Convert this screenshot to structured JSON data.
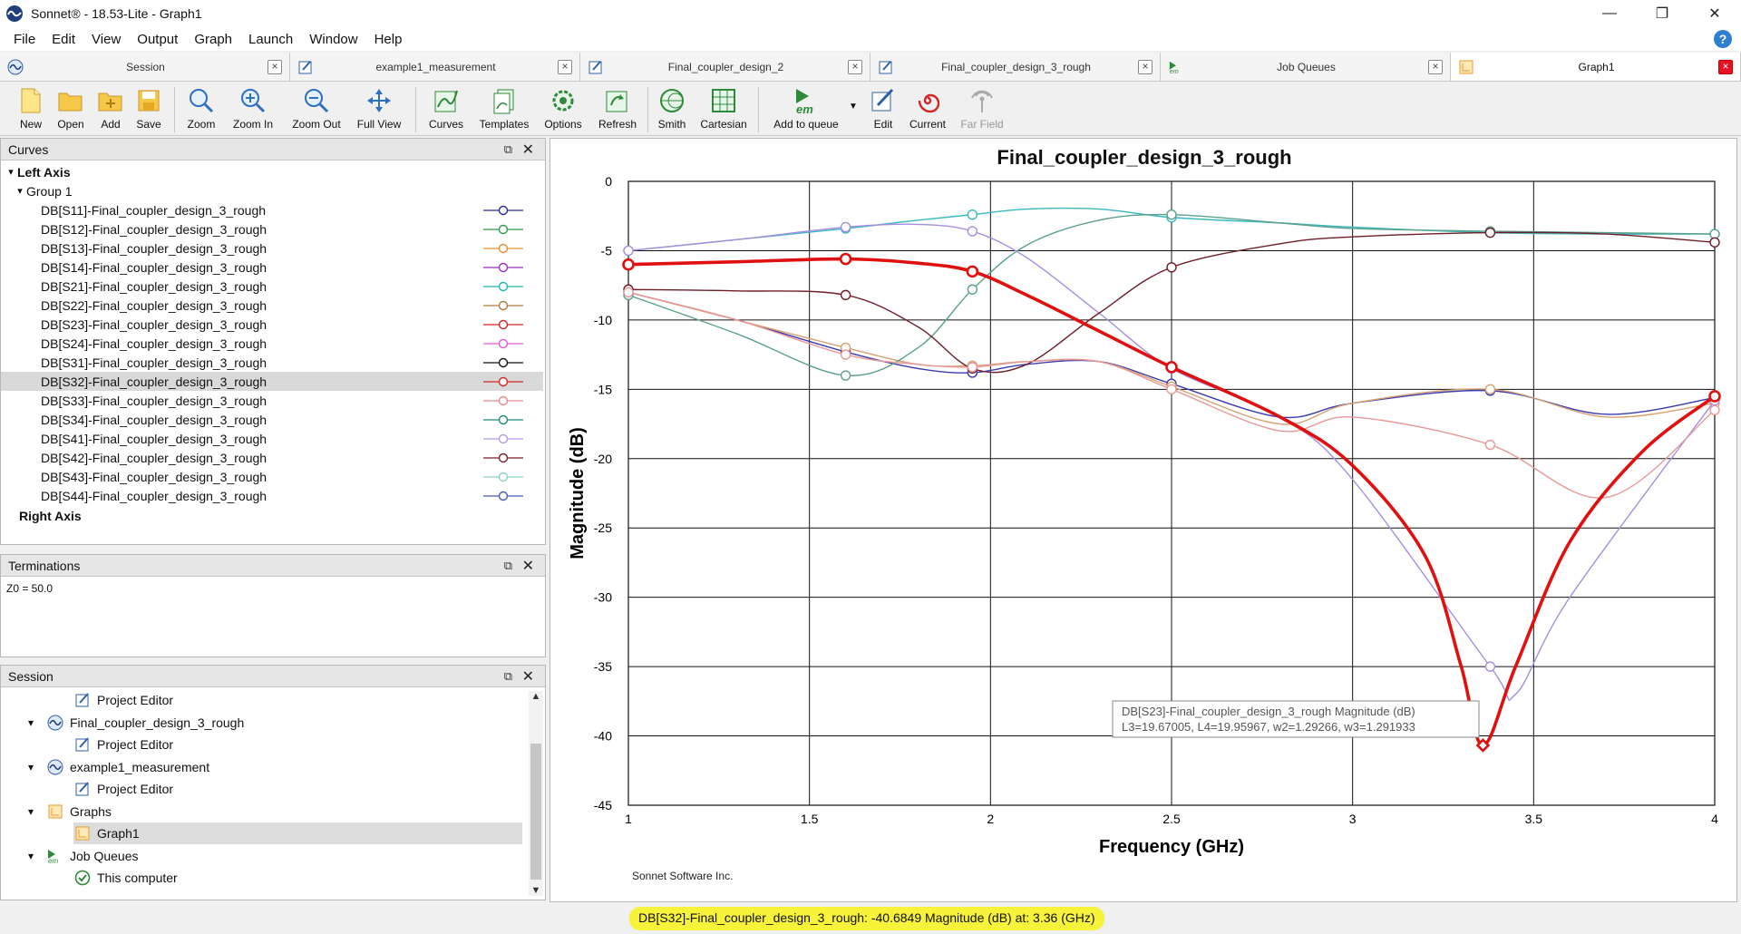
{
  "window": {
    "title": "Sonnet® - 18.53-Lite - Graph1",
    "minimize": "—",
    "restore": "❐",
    "close": "✕"
  },
  "menu": [
    "File",
    "Edit",
    "View",
    "Output",
    "Graph",
    "Launch",
    "Window",
    "Help"
  ],
  "help_glyph": "?",
  "tabs": [
    {
      "label": "Session",
      "icon": "session-icon",
      "active": false
    },
    {
      "label": "example1_measurement",
      "icon": "project-editor-icon",
      "active": false
    },
    {
      "label": "Final_coupler_design_2",
      "icon": "project-editor-icon",
      "active": false
    },
    {
      "label": "Final_coupler_design_3_rough",
      "icon": "project-editor-icon",
      "active": false
    },
    {
      "label": "Job Queues",
      "icon": "em-icon",
      "active": false
    },
    {
      "label": "Graph1",
      "icon": "graph-icon",
      "active": true
    }
  ],
  "tab_close": "×",
  "toolbar": {
    "new": "New",
    "open": "Open",
    "add": "Add",
    "save": "Save",
    "zoom": "Zoom",
    "zoom_in": "Zoom In",
    "zoom_out": "Zoom Out",
    "full_view": "Full View",
    "curves": "Curves",
    "templates": "Templates",
    "options": "Options",
    "refresh": "Refresh",
    "smith": "Smith",
    "cartesian": "Cartesian",
    "add_to_queue": "Add to queue",
    "edit": "Edit",
    "current": "Current",
    "far_field": "Far Field"
  },
  "curves_panel": {
    "title": "Curves",
    "left_axis": "Left Axis",
    "group": "Group 1",
    "right_axis": "Right Axis",
    "items": [
      {
        "label": "DB[S11]-Final_coupler_design_3_rough",
        "color": "#2b2b9e"
      },
      {
        "label": "DB[S12]-Final_coupler_design_3_rough",
        "color": "#2e9a4a"
      },
      {
        "label": "DB[S13]-Final_coupler_design_3_rough",
        "color": "#e8902c"
      },
      {
        "label": "DB[S14]-Final_coupler_design_3_rough",
        "color": "#9a2fc4"
      },
      {
        "label": "DB[S21]-Final_coupler_design_3_rough",
        "color": "#1fb8b8"
      },
      {
        "label": "DB[S22]-Final_coupler_design_3_rough",
        "color": "#b07a3a"
      },
      {
        "label": "DB[S23]-Final_coupler_design_3_rough",
        "color": "#d42424"
      },
      {
        "label": "DB[S24]-Final_coupler_design_3_rough",
        "color": "#e05ad8"
      },
      {
        "label": "DB[S31]-Final_coupler_design_3_rough",
        "color": "#111111"
      },
      {
        "label": "DB[S32]-Final_coupler_design_3_rough",
        "color": "#d42424"
      },
      {
        "label": "DB[S33]-Final_coupler_design_3_rough",
        "color": "#e88a8a"
      },
      {
        "label": "DB[S34]-Final_coupler_design_3_rough",
        "color": "#1d8a7a"
      },
      {
        "label": "DB[S41]-Final_coupler_design_3_rough",
        "color": "#b59ae8"
      },
      {
        "label": "DB[S42]-Final_coupler_design_3_rough",
        "color": "#7a1f2a"
      },
      {
        "label": "DB[S43]-Final_coupler_design_3_rough",
        "color": "#8ad6b8"
      },
      {
        "label": "DB[S44]-Final_coupler_design_3_rough",
        "color": "#4a5ab0"
      }
    ],
    "selected_index": 9
  },
  "terminations": {
    "title": "Terminations",
    "text": "Z0 = 50.0"
  },
  "session": {
    "title": "Session",
    "rows": [
      {
        "label": "Project Editor",
        "icon": "project-editor-icon",
        "indent": 2,
        "chevron": ""
      },
      {
        "label": "Final_coupler_design_3_rough",
        "icon": "session-icon",
        "indent": 1,
        "chevron": "▾"
      },
      {
        "label": "Project Editor",
        "icon": "project-editor-icon",
        "indent": 2,
        "chevron": ""
      },
      {
        "label": "example1_measurement",
        "icon": "session-icon",
        "indent": 1,
        "chevron": "▾"
      },
      {
        "label": "Project Editor",
        "icon": "project-editor-icon",
        "indent": 2,
        "chevron": ""
      },
      {
        "label": "Graphs",
        "icon": "graph-icon",
        "indent": 1,
        "chevron": "▾"
      },
      {
        "label": "Graph1",
        "icon": "graph-icon",
        "indent": 2,
        "chevron": ""
      },
      {
        "label": "Job Queues",
        "icon": "em-icon",
        "indent": 1,
        "chevron": "▾"
      },
      {
        "label": "This computer",
        "icon": "check-icon",
        "indent": 2,
        "chevron": ""
      }
    ],
    "selected_index": 6
  },
  "panel_float": "⧉",
  "panel_close": "✕",
  "graph": {
    "title": "Final_coupler_design_3_rough",
    "xlabel": "Frequency (GHz)",
    "ylabel": "Magnitude (dB)",
    "footer": "Sonnet Software Inc.",
    "tooltip_line1": "DB[S23]-Final_coupler_design_3_rough Magnitude (dB)",
    "tooltip_line2": "L3=19.67005, L4=19.95967, w2=1.29266, w3=1.291933"
  },
  "status_text": "DB[S32]-Final_coupler_design_3_rough: -40.6849 Magnitude (dB) at: 3.36 (GHz)",
  "chart_data": {
    "type": "line",
    "title": "Final_coupler_design_3_rough",
    "xlabel": "Frequency (GHz)",
    "ylabel": "Magnitude (dB)",
    "xlim": [
      1,
      4
    ],
    "ylim": [
      -45,
      0
    ],
    "xticks": [
      "1",
      "1.5",
      "2",
      "2.5",
      "3",
      "3.5",
      "4"
    ],
    "yticks": [
      "0",
      "-5",
      "-10",
      "-15",
      "-20",
      "-25",
      "-30",
      "-35",
      "-40",
      "-45"
    ],
    "grid": true,
    "highlight_series": "DB[S32]-Final_coupler_design_3_rough",
    "marker_x": [
      1,
      1.6,
      1.95,
      2.5,
      3.38,
      4
    ],
    "series": [
      {
        "name": "DB[S11]-Final_coupler_design_3_rough",
        "color": "#3a3ab0",
        "x": [
          1,
          1.3,
          1.6,
          1.8,
          1.95,
          2.1,
          2.3,
          2.5,
          2.8,
          3.0,
          3.38,
          3.7,
          4
        ],
        "y": [
          -8,
          -10,
          -12.3,
          -13.5,
          -13.8,
          -13.2,
          -13.0,
          -14.6,
          -17.0,
          -16.0,
          -15.1,
          -16.8,
          -15.6
        ]
      },
      {
        "name": "DB[S13]-Final_coupler_design_3_rough",
        "color": "#d8a070",
        "x": [
          1,
          1.3,
          1.6,
          1.8,
          1.95,
          2.1,
          2.3,
          2.5,
          2.8,
          3.0,
          3.38,
          3.7,
          4
        ],
        "y": [
          -8,
          -10,
          -12,
          -13.2,
          -13.3,
          -13.0,
          -13.0,
          -14.8,
          -17.5,
          -16.0,
          -15.0,
          -17.0,
          -16.0
        ]
      },
      {
        "name": "DB[S21]-Final_coupler_design_3_rough",
        "color": "#3ab8c0",
        "x": [
          1,
          1.3,
          1.6,
          1.8,
          1.95,
          2.1,
          2.3,
          2.5,
          2.8,
          3.0,
          3.38,
          3.7,
          4
        ],
        "y": [
          -5,
          -4.2,
          -3.4,
          -2.8,
          -2.4,
          -2.0,
          -2.0,
          -2.6,
          -3.0,
          -3.3,
          -3.7,
          -3.8,
          -3.8
        ]
      },
      {
        "name": "DB[S34]-Final_coupler_design_3_rough",
        "color": "#5aa08a",
        "x": [
          1,
          1.3,
          1.6,
          1.8,
          1.95,
          2.1,
          2.3,
          2.5,
          2.8,
          3.0,
          3.38,
          3.7,
          4
        ],
        "y": [
          -8.2,
          -11,
          -14,
          -12,
          -7.8,
          -4.6,
          -2.8,
          -2.4,
          -3.0,
          -3.4,
          -3.6,
          -3.7,
          -3.8
        ]
      },
      {
        "name": "DB[S41]-Final_coupler_design_3_rough",
        "color": "#a78ee0",
        "x": [
          1,
          1.3,
          1.6,
          1.8,
          1.95,
          2.1,
          2.3,
          2.5,
          2.8,
          3.0,
          3.38,
          3.45,
          3.6,
          4
        ],
        "y": [
          -5,
          -4.2,
          -3.3,
          -3.1,
          -3.6,
          -5.5,
          -9.5,
          -13.5,
          -17.0,
          -21.5,
          -35.0,
          -37.0,
          -30.0,
          -15.8
        ]
      },
      {
        "name": "DB[S42]-Final_coupler_design_3_rough",
        "color": "#6e1e28",
        "x": [
          1,
          1.3,
          1.6,
          1.8,
          1.95,
          2.1,
          2.3,
          2.5,
          2.8,
          3.0,
          3.38,
          3.7,
          4
        ],
        "y": [
          -7.8,
          -7.9,
          -8.2,
          -10.5,
          -13.5,
          -13.2,
          -9.5,
          -6.2,
          -4.5,
          -4.0,
          -3.7,
          -3.8,
          -4.4
        ]
      },
      {
        "name": "DB[S33]-Final_coupler_design_3_rough",
        "color": "#e89898",
        "x": [
          1,
          1.3,
          1.6,
          1.8,
          1.95,
          2.1,
          2.3,
          2.5,
          2.8,
          3.0,
          3.38,
          3.7,
          4
        ],
        "y": [
          -8,
          -10,
          -12.5,
          -13.2,
          -13.4,
          -13.0,
          -13.0,
          -15.0,
          -18.0,
          -17.0,
          -19.0,
          -22.8,
          -16.5
        ]
      },
      {
        "name": "DB[S32]-Final_coupler_design_3_rough",
        "color": "#e01010",
        "x": [
          1,
          1.3,
          1.6,
          1.8,
          1.95,
          2.1,
          2.3,
          2.5,
          2.8,
          3.0,
          3.2,
          3.3,
          3.36,
          3.45,
          3.6,
          3.8,
          4
        ],
        "y": [
          -6,
          -5.8,
          -5.6,
          -5.9,
          -6.5,
          -8.2,
          -10.8,
          -13.4,
          -17.0,
          -20.5,
          -27.0,
          -35.0,
          -40.68,
          -35.0,
          -26.0,
          -19.5,
          -15.5
        ]
      }
    ]
  }
}
